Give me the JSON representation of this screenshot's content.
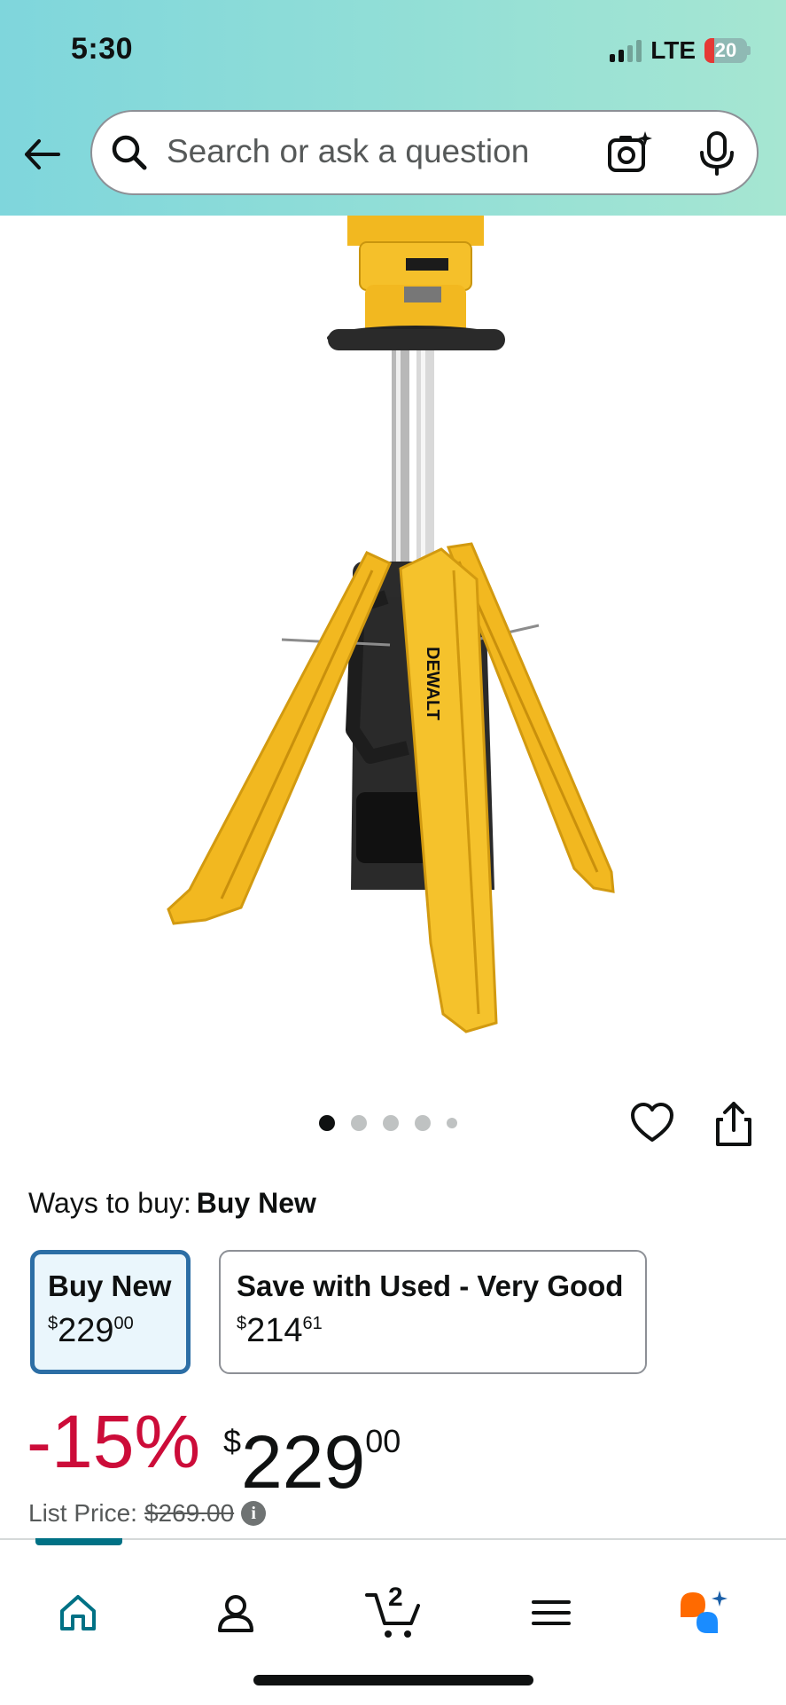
{
  "status_bar": {
    "time": "5:30",
    "network": "LTE",
    "battery_level": "20",
    "battery_color": "#e53935"
  },
  "header": {
    "back_icon": "arrow-left-icon",
    "search": {
      "placeholder": "Search or ask a question",
      "camera_icon": "camera-sparkle-icon",
      "mic_icon": "microphone-icon"
    },
    "gradient_colors": [
      "#7fd6dc",
      "#a6e6d2"
    ]
  },
  "product": {
    "image_alt": "DEWALT tripod work light",
    "brand_text": "DEWALT",
    "carousel": {
      "total": 5,
      "active_index": 0
    },
    "actions": {
      "wishlist_icon": "heart-icon",
      "share_icon": "share-icon"
    }
  },
  "ways_to_buy": {
    "label": "Ways to buy:",
    "selected": "Buy New",
    "options": [
      {
        "title": "Buy New",
        "currency": "$",
        "whole": "229",
        "fraction": "00",
        "selected": true
      },
      {
        "title": "Save with Used - Very Good",
        "currency": "$",
        "whole": "214",
        "fraction": "61",
        "selected": false
      }
    ]
  },
  "pricing": {
    "discount": "-15%",
    "currency": "$",
    "whole": "229",
    "fraction": "00",
    "list_price_label": "List Price:",
    "list_price_value": "$269.00",
    "discount_color": "#cc0c39"
  },
  "bottom_nav": {
    "items": [
      "home-icon",
      "account-icon",
      "cart-icon",
      "menu-icon",
      "rufus-icon"
    ],
    "active": "home-icon",
    "cart_count": "2",
    "accent_color": "#007185"
  }
}
